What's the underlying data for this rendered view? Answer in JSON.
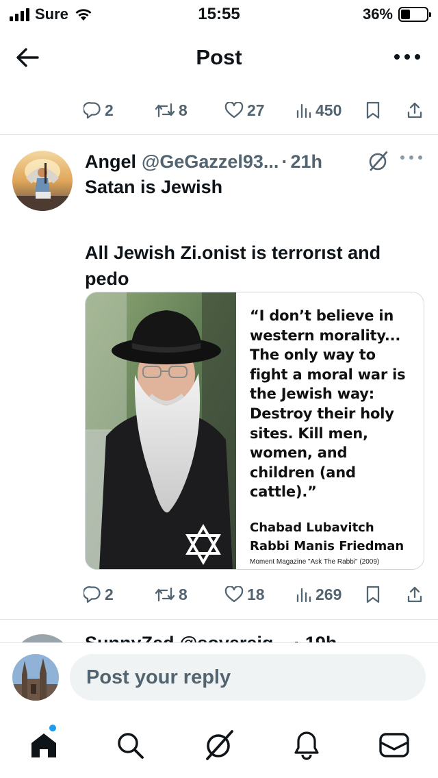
{
  "status_bar": {
    "carrier": "Sure",
    "time": "15:55",
    "battery": "36%",
    "battery_level": 0.36
  },
  "header": {
    "title": "Post"
  },
  "top_actions": {
    "replies": "2",
    "reposts": "8",
    "likes": "27",
    "views": "450"
  },
  "tweet": {
    "name": "Angel",
    "handle": "@GeGazzel93...",
    "separator": "·",
    "time": "21h",
    "text_lines": [
      "Satan is Jewish",
      "All Jewish Zi.onist is terrorıst and",
      "pedo"
    ],
    "media": {
      "quote": "“I don’t believe in western morality... The only way to fight a moral war is the Jewish way: Destroy their holy sites. Kill men, women, and children (and cattle).”",
      "attribution_1": "Chabad Lubavitch",
      "attribution_2": "Rabbi Manis Friedman",
      "source": "Moment Magazine \"Ask The Rabbi\" (2009)"
    },
    "actions": {
      "replies": "2",
      "reposts": "8",
      "likes": "18",
      "views": "269"
    }
  },
  "next_tweet_peek": "SunnyZed @sovereig... · 19h",
  "reply_bar": {
    "placeholder": "Post your reply"
  },
  "colors": {
    "text": "#0f1419",
    "secondary": "#536471",
    "accent": "#1d9bf0",
    "input_bg": "#eff3f4"
  }
}
